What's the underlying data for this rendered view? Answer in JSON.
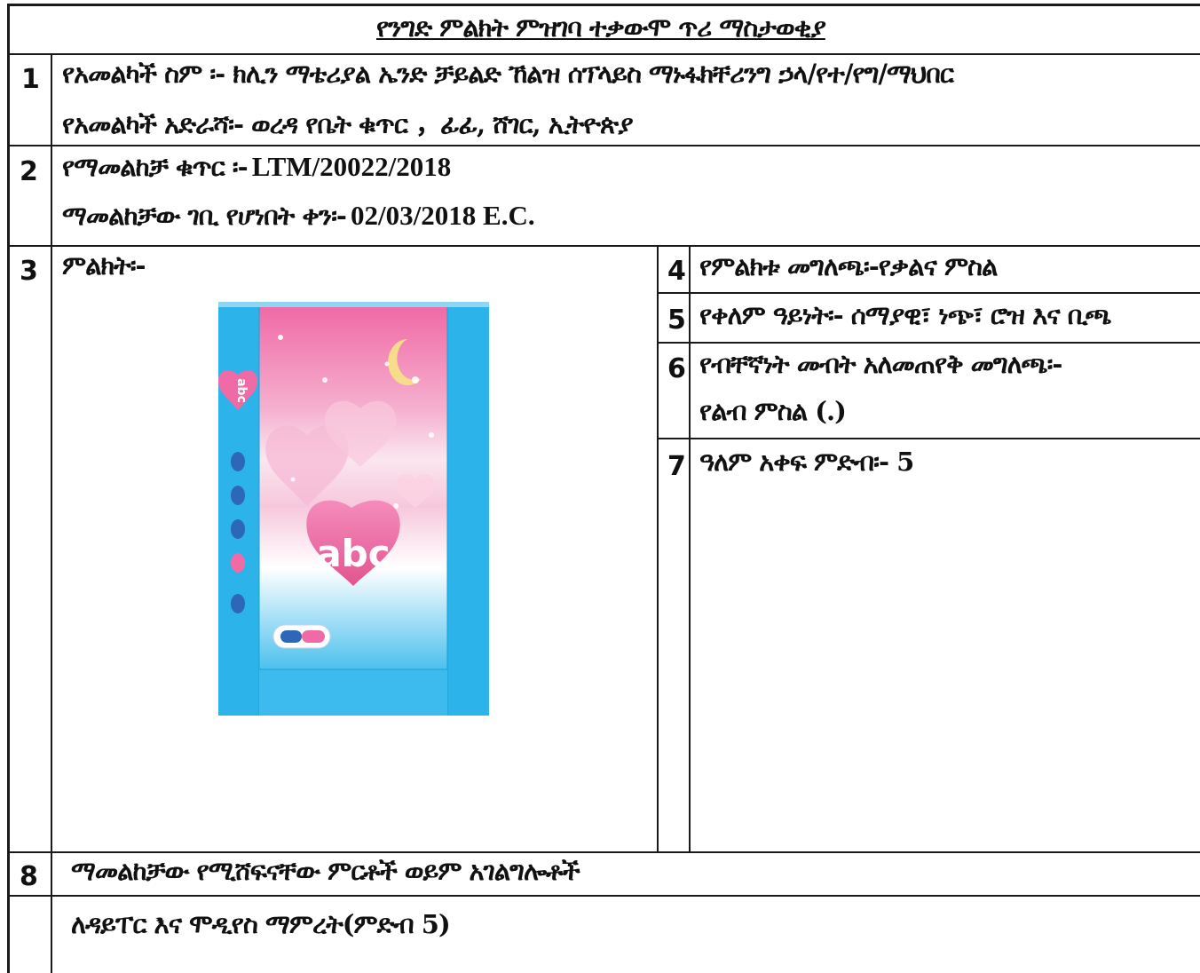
{
  "title": "የንግድ ምልክት ምዝገባ ተቃውሞ ጥሪ ማስታወቂያ",
  "rows": {
    "r1": {
      "num": "1",
      "line1": "የአመልካች ስም ፡- ክሊን ማቴሪያል ኤንድ ቻይልድ ኸልዝ ሰፕላይስ ማኑፋክቸሪንግ ኃላ/የተ/የግ/ማህበር",
      "line2": "የአመልካች አድራሻ፡- ወረዳ የቤት ቁጥር ，ፊፊ, ሸገር, ኢትዮጵያ"
    },
    "r2": {
      "num": "2",
      "label1": "የማመልከቻ ቁጥር ፡-",
      "value1": "LTM/20022/2018",
      "label2": "ማመልከቻው ገቢ የሆነበት ቀን፡-",
      "value2": "02/03/2018 E.C."
    },
    "r3": {
      "num": "3",
      "label": "ምልክት፡-"
    },
    "r4": {
      "num": "4",
      "text": "የምልክቱ መግለጫ፡-የቃልና ምስል"
    },
    "r5": {
      "num": "5",
      "text": "የቀለም ዓይነት፡- ሰማያዊ፣ ነጭ፣ ሮዝ እና ቢጫ"
    },
    "r6": {
      "num": "6",
      "line1": "የብቸኛነት መብት አለመጠየቅ መግለጫ፡-",
      "line2": "የልብ ምስል (.)"
    },
    "r7": {
      "num": "7",
      "text": "ዓለም አቀፍ ምድብ፡- 5"
    },
    "r8": {
      "num": "8",
      "line1": "ማመልከቻው የሚሸፍናቸው ምርቶች ወይም አገልግሎቶች",
      "line2": "ለዳይፐር እና ሞዲየስ ማምረት(ምድብ 5)"
    }
  },
  "mark": {
    "brand_text": "abc",
    "colors": {
      "blue": "#29b2e8",
      "pink": "#f06aa6",
      "white": "#ffffff",
      "yellow": "#f7dc8a"
    }
  }
}
